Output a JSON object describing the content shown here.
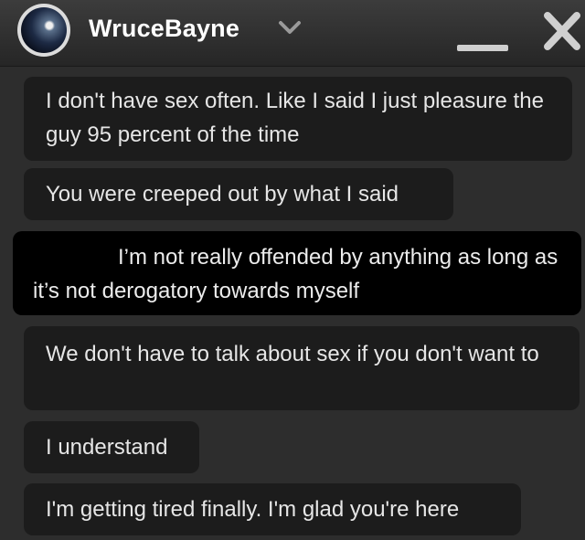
{
  "header": {
    "contact_name": "WruceBayne"
  },
  "messages": [
    {
      "direction": "incoming",
      "text": "I don't have sex often. Like I said I just pleasure the guy 95 percent of the time"
    },
    {
      "direction": "incoming",
      "text": "You were creeped out by what I said"
    },
    {
      "direction": "outgoing",
      "text": "I’m not really offended by anything as long as it’s not derogatory towards myself"
    },
    {
      "direction": "incoming",
      "text": "We don't have to talk about sex if you don't want to"
    },
    {
      "direction": "incoming",
      "text": "I understand"
    },
    {
      "direction": "incoming",
      "text": "I'm getting tired finally. I'm glad you're here"
    }
  ],
  "colors": {
    "incoming_bubble": "#1c1c1c",
    "outgoing_bubble": "#000000",
    "background": "#2d2d2d"
  },
  "icons": [
    "avatar",
    "chevron-down-icon",
    "minimize-icon",
    "close-icon"
  ]
}
